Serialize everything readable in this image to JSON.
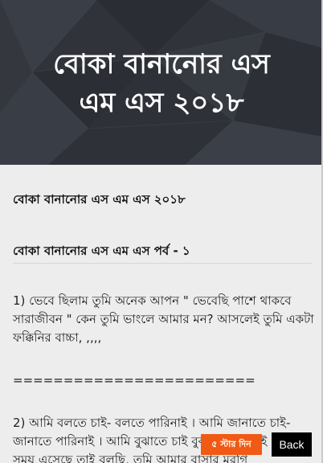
{
  "header": {
    "title_line1": "বোকা বানানোর এস",
    "title_line2": "এম এস ২০১৮"
  },
  "content": {
    "heading1": "বোকা বানানোর এস এম এস ২০১৮",
    "heading2": "বোকা বানানোর এস এম এস পর্ব - ১",
    "para1": "1) ভেবে ছিলাম তুমি অনেক আপন \" ভেবেছি পাশে থাকবে সারাজীবন \" কেন তুমি ভাংলে আমার মন? আসলেই তুমি একটা ফক্কিনির বাচ্চা, ,,,,",
    "separator": "========================",
    "para2": "2) আমি বলতে চাই- বলতে পারিনাই । আমি জানাতে চাই- জানাতে পারিনাই । আমি বুঝাতে চাই বুঝাতে পারিনাই । আজ সময় এসেছে তাই বলছি, তুমি আমার বাসার মুরগি"
  },
  "buttons": {
    "rate_label": "৫ স্টার দিন",
    "back_label": "Back"
  },
  "colors": {
    "header_bg": "#2f3238",
    "content_bg": "#ededed",
    "rate_button": "#f05a14",
    "back_button": "#000000"
  }
}
